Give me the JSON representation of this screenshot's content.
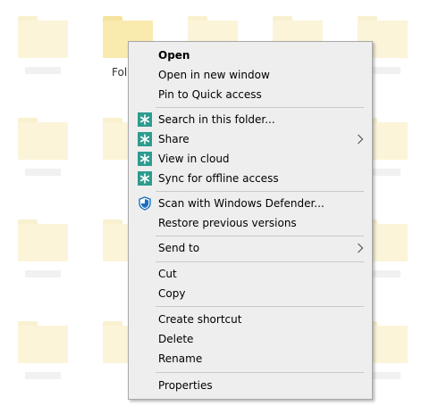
{
  "desktop": {
    "selected_folder_label": "Fol"
  },
  "context_menu": {
    "items": [
      {
        "label": "Open"
      },
      {
        "label": "Open in new window"
      },
      {
        "label": "Pin to Quick access"
      },
      {
        "label": "Search in this folder...",
        "icon": "onedrive-sync-icon"
      },
      {
        "label": "Share",
        "icon": "onedrive-sync-icon"
      },
      {
        "label": "View in cloud",
        "icon": "onedrive-sync-icon"
      },
      {
        "label": "Sync for offline access",
        "icon": "onedrive-sync-icon"
      },
      {
        "label": "Scan with Windows Defender...",
        "icon": "windows-defender-icon"
      },
      {
        "label": "Restore previous versions"
      },
      {
        "label": "Send to"
      },
      {
        "label": "Cut"
      },
      {
        "label": "Copy"
      },
      {
        "label": "Create shortcut"
      },
      {
        "label": "Delete"
      },
      {
        "label": "Rename"
      },
      {
        "label": "Properties"
      }
    ]
  },
  "colors": {
    "menu_background": "#eeeeee",
    "sync_icon_teal": "#2d9c8f",
    "defender_blue": "#1a6fc2",
    "folder_fill": "#fbf4d8",
    "selected_folder_fill": "#f9eaae"
  }
}
